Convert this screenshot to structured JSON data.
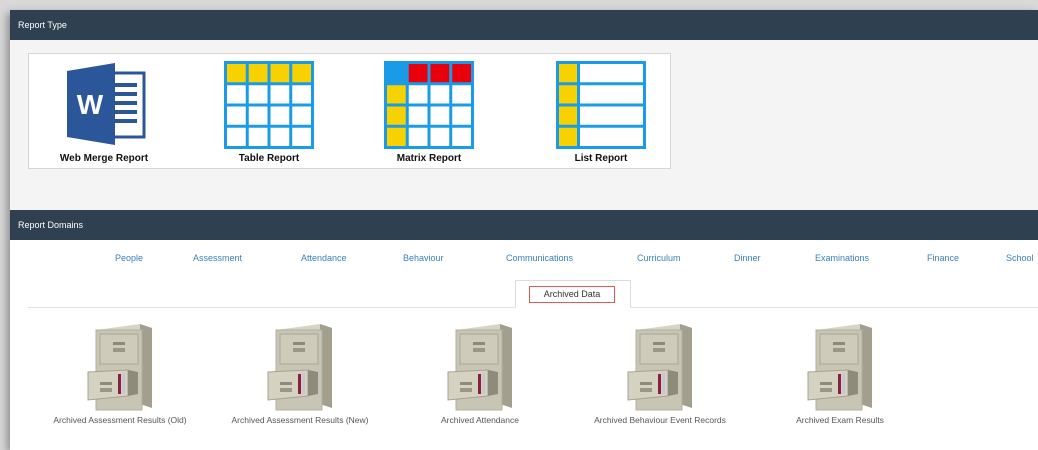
{
  "report_type": {
    "header": "Report Type",
    "items": [
      {
        "label": "Web Merge Report",
        "icon": "word-document-icon"
      },
      {
        "label": "Table Report",
        "icon": "table-grid-icon"
      },
      {
        "label": "Matrix Report",
        "icon": "matrix-grid-icon"
      },
      {
        "label": "List Report",
        "icon": "list-grid-icon"
      }
    ]
  },
  "report_domains": {
    "header": "Report Domains",
    "tabs": [
      "People",
      "Assessment",
      "Attendance",
      "Behaviour",
      "Communications",
      "Curriculum",
      "Dinner",
      "Examinations",
      "Finance",
      "School"
    ],
    "active_tab": "Archived Data",
    "items": [
      {
        "label": "Archived Assessment Results (Old)",
        "icon": "filing-cabinet-icon"
      },
      {
        "label": "Archived Assessment Results (New)",
        "icon": "filing-cabinet-icon"
      },
      {
        "label": "Archived Attendance",
        "icon": "filing-cabinet-icon"
      },
      {
        "label": "Archived Behaviour Event Records",
        "icon": "filing-cabinet-icon"
      },
      {
        "label": "Archived Exam Results",
        "icon": "filing-cabinet-icon"
      }
    ]
  },
  "colors": {
    "header_bg": "#2f4050",
    "grid_blue": "#1a9be8",
    "grid_yellow": "#f7d100",
    "grid_red": "#e8000d",
    "word_blue": "#2b579a",
    "link_blue": "#3a7fbf",
    "active_outline": "#e05a5a"
  }
}
